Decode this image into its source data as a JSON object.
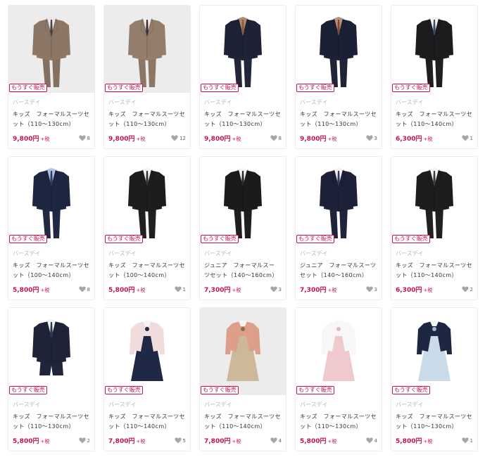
{
  "badge_text": "もうすぐ販売",
  "tax_text": "+税",
  "colors": {
    "accent": "#c4134c",
    "heart": "#a6a6a6",
    "border": "#ececec"
  },
  "products": [
    {
      "brand": "バースデイ",
      "name_line1": "キッズ　フォーマルスーツセ",
      "name_line2": "ット（110〜130cm）",
      "price": "9,800円",
      "likes": "8",
      "image": "beige-suit-front",
      "bg": "#ececec",
      "outfit": "beige",
      "jacket": "#8c7766",
      "pants": "#857060",
      "shirt": "#e8e8ea",
      "tie": "#444444"
    },
    {
      "brand": "バースデイ",
      "name_line1": "キッズ　フォーマルスーツセ",
      "name_line2": "ット（110〜130cm）",
      "price": "9,800円",
      "likes": "12",
      "image": "beige-suit-bowtie",
      "bg": "#ececec",
      "outfit": "beige",
      "jacket": "#947d6b",
      "pants": "#8d7664",
      "shirt": "#ececee",
      "tie": "#3a3535"
    },
    {
      "brand": "バースデイ",
      "name_line1": "キッズ　フォーマルスーツセ",
      "name_line2": "ット（110〜130cm）",
      "price": "9,800円",
      "likes": "8",
      "image": "navy-suit-checked-collar",
      "bg": "#ffffff",
      "outfit": "boy",
      "jacket": "#1d2236",
      "pants": "#22263a",
      "shirt": "#b08a6c",
      "tie": "#8a5a44"
    },
    {
      "brand": "バースデイ",
      "name_line1": "キッズ　フォーマルスーツセ",
      "name_line2": "ット（110〜130cm）",
      "price": "9,800円",
      "likes": "3",
      "image": "navy-suit-checked-collar-2",
      "bg": "#ffffff",
      "outfit": "boy",
      "jacket": "#1b2034",
      "pants": "#1f2437",
      "shirt": "#b5927a",
      "tie": "#7a4a3a"
    },
    {
      "brand": "バースデイ",
      "name_line1": "キッズ　フォーマルスーツセ",
      "name_line2": "ット（110〜140cm）",
      "price": "6,300円",
      "likes": "1",
      "image": "black-suit",
      "bg": "#ffffff",
      "outfit": "boy",
      "jacket": "#1c1c1e",
      "pants": "#1e1e20",
      "shirt": "#f2f2f2",
      "tie": "#3b4a6a"
    },
    {
      "brand": "バースデイ",
      "name_line1": "キッズ　フォーマルスーツセ",
      "name_line2": "ット（100〜140cm）",
      "price": "5,800円",
      "likes": "8",
      "image": "navy-suit-blue-shirt",
      "bg": "#ffffff",
      "outfit": "boy",
      "jacket": "#1e2540",
      "pants": "#212843",
      "shirt": "#a9c1e2",
      "tie": "#2e3a66"
    },
    {
      "brand": "バースデイ",
      "name_line1": "キッズ　フォーマルスーツセ",
      "name_line2": "ット（100〜140cm）",
      "price": "5,800円",
      "likes": "1",
      "image": "black-suit-long",
      "bg": "#ffffff",
      "outfit": "boy",
      "jacket": "#1d1d1f",
      "pants": "#202022",
      "shirt": "#f0f0f0",
      "tie": "#333333"
    },
    {
      "brand": "バースデイ",
      "name_line1": "ジュニア　フォーマルスー",
      "name_line2": "ツセット（140〜160cm）",
      "price": "7,300円",
      "likes": "3",
      "image": "black-junior-suit",
      "bg": "#ffffff",
      "outfit": "boy",
      "jacket": "#1b1b1d",
      "pants": "#1e1e20",
      "shirt": "#f2f2f2",
      "tie": "#2a2a2a"
    },
    {
      "brand": "バースデイ",
      "name_line1": "ジュニア　フォーマルスーツ",
      "name_line2": "セット（140〜160cm）",
      "price": "7,300円",
      "likes": "3",
      "image": "navy-junior-suit",
      "bg": "#ffffff",
      "outfit": "boy",
      "jacket": "#1c2137",
      "pants": "#1f243a",
      "shirt": "#f0f0f2",
      "tie": "#2f3a5e"
    },
    {
      "brand": "バースデイ",
      "name_line1": "キッズ　フォーマルスーツセ",
      "name_line2": "ット（110〜140cm）",
      "price": "6,300円",
      "likes": "2",
      "image": "black-suit-2",
      "bg": "#ffffff",
      "outfit": "boy",
      "jacket": "#1d1d1f",
      "pants": "#202022",
      "shirt": "#f0f0f0",
      "tie": "#3a3a3a"
    },
    {
      "brand": "バースデイ",
      "name_line1": "キッズ　フォーマルスーツセ",
      "name_line2": "ット（110〜130cm）",
      "price": "5,800円",
      "likes": "2",
      "image": "navy-shorts-suit",
      "bg": "#ffffff",
      "outfit": "shorts",
      "jacket": "#1e2338",
      "pants": "#20253a",
      "shirt": "#f2f2f4",
      "tie": "#2c3556"
    },
    {
      "brand": "バースデイ",
      "name_line1": "キッズ　フォーマルスーツセ",
      "name_line2": "ット（110〜140cm）",
      "price": "7,800円",
      "likes": "5",
      "image": "pink-bolero-navy-dress",
      "bg": "#ffffff",
      "outfit": "girl",
      "jacket": "#f0dcdc",
      "pants": "#1f2845",
      "shirt": "#f5f5f5",
      "tie": "#1f2845"
    },
    {
      "brand": "バースデイ",
      "name_line1": "キッズ　フォーマルスーツセ",
      "name_line2": "ット（110〜140cm）",
      "price": "7,800円",
      "likes": "4",
      "image": "salmon-bolero-check-dress",
      "bg": "#ececec",
      "outfit": "girl",
      "jacket": "#dd9f89",
      "pants": "#cdb89a",
      "shirt": "#f5f5f5",
      "tie": "#8a6d52"
    },
    {
      "brand": "バースデイ",
      "name_line1": "キッズ　フォーマルスーツセ",
      "name_line2": "ット（110〜130cm）",
      "price": "5,800円",
      "likes": "4",
      "image": "white-bolero-pink-dress",
      "bg": "#ffffff",
      "outfit": "girl",
      "jacket": "#f7f7f7",
      "pants": "#f0c9cf",
      "shirt": "#f7f7f7",
      "tie": "#e6b8c0"
    },
    {
      "brand": "バースデイ",
      "name_line1": "キッズ　フォーマルスーツセ",
      "name_line2": "ット（110〜130cm）",
      "price": "5,800円",
      "likes": "1",
      "image": "navy-bolero-plaid-dress",
      "bg": "#ffffff",
      "outfit": "girl",
      "jacket": "#1e2742",
      "pants": "#c9dbe8",
      "shirt": "#f5f5f5",
      "tie": "#9fb7d1"
    }
  ]
}
